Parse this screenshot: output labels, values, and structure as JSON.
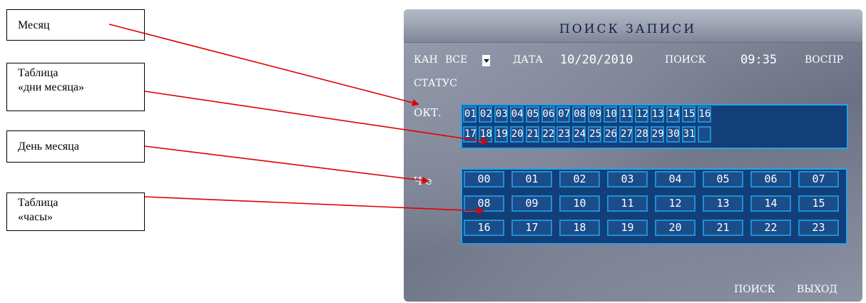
{
  "callouts": {
    "month": "Месяц",
    "days_table_1": "Таблица",
    "days_table_2": "«дни месяца»",
    "day": "День месяца",
    "hours_table_1": "Таблица",
    "hours_table_2": "«часы»"
  },
  "screen": {
    "title": "ПОИСК ЗАПИСИ",
    "channel_label": "КАН",
    "channel_value": "ВСЕ",
    "date_label": "ДАТА",
    "date_value": "10/20/2010",
    "search_button": "ПОИСК",
    "time_value": "09:35",
    "play_button": "ВОСПР",
    "status_label": "СТАТУС",
    "month_label": "ОКТ.",
    "hour_label": "Ч-е",
    "days": [
      "01",
      "02",
      "03",
      "04",
      "05",
      "06",
      "07",
      "08",
      "09",
      "10",
      "11",
      "12",
      "13",
      "14",
      "15",
      "16",
      "17",
      "18",
      "19",
      "20",
      "21",
      "22",
      "23",
      "24",
      "25",
      "26",
      "27",
      "28",
      "29",
      "30",
      "31",
      ""
    ],
    "hours": [
      "00",
      "01",
      "02",
      "03",
      "04",
      "05",
      "06",
      "07",
      "08",
      "09",
      "10",
      "11",
      "12",
      "13",
      "14",
      "15",
      "16",
      "17",
      "18",
      "19",
      "20",
      "21",
      "22",
      "23"
    ],
    "bottom_search": "ПОИСК",
    "bottom_exit": "ВЫХОД"
  },
  "colors": {
    "cell_fill": "#1a4d8a",
    "cell_border": "#1f8fd6",
    "arrow": "#e00000"
  }
}
